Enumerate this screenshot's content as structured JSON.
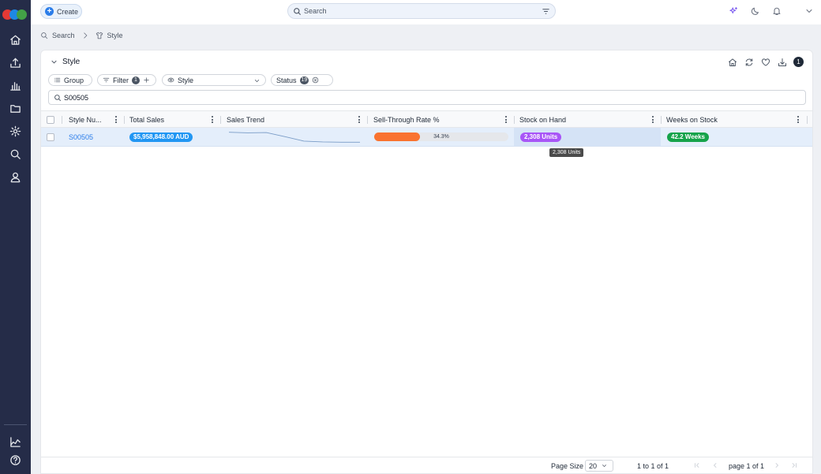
{
  "app": {
    "colors": {
      "sidebar": "#252c48",
      "accent": "#2b7de9",
      "logo": [
        "#e53935",
        "#1e88e5",
        "#43a047"
      ]
    }
  },
  "topbar": {
    "create_label": "Create",
    "search_placeholder": "Search",
    "icons": [
      "sparkle-icon",
      "moon-icon",
      "bell-icon",
      "chevron-down-icon"
    ]
  },
  "sidebar": {
    "items": [
      "home-icon",
      "upload-icon",
      "bar-chart-icon",
      "folder-icon",
      "settings-icon",
      "search-icon",
      "user-icon"
    ],
    "bottom_items": [
      "report-icon",
      "help-icon"
    ]
  },
  "breadcrumb": {
    "items": [
      {
        "label": "Search",
        "icon": "search-icon"
      },
      {
        "label": "Style",
        "icon": "shirt-icon"
      }
    ]
  },
  "panel": {
    "title": "Style",
    "badge_count": "1",
    "chips": {
      "group_label": "Group",
      "filter_label": "Filter",
      "filter_count": "1",
      "view_label": "Style",
      "status_label": "Status",
      "status_count": "19"
    },
    "search_value": "S00505"
  },
  "table": {
    "columns": [
      "Style Nu...",
      "Total Sales",
      "Sales Trend",
      "Sell-Through Rate %",
      "Stock on Hand",
      "Weeks on Stock"
    ],
    "rows": [
      {
        "style_number": "S00505",
        "total_sales": "$5,958,848.00 AUD",
        "sales_trend": [
          0.95,
          0.9,
          0.92,
          0.55,
          0.15,
          0.08,
          0.05,
          0.05
        ],
        "sell_through_pct": 34.3,
        "sell_through_label": "34.3%",
        "stock_on_hand": "2,308 Units",
        "weeks_on_stock": "42.2 Weeks"
      }
    ],
    "tooltip": "2,308 Units"
  },
  "footer": {
    "page_size_label": "Page Size",
    "page_size_value": "20",
    "range_text": "1 to 1 of 1",
    "page_text": "page 1 of 1"
  }
}
